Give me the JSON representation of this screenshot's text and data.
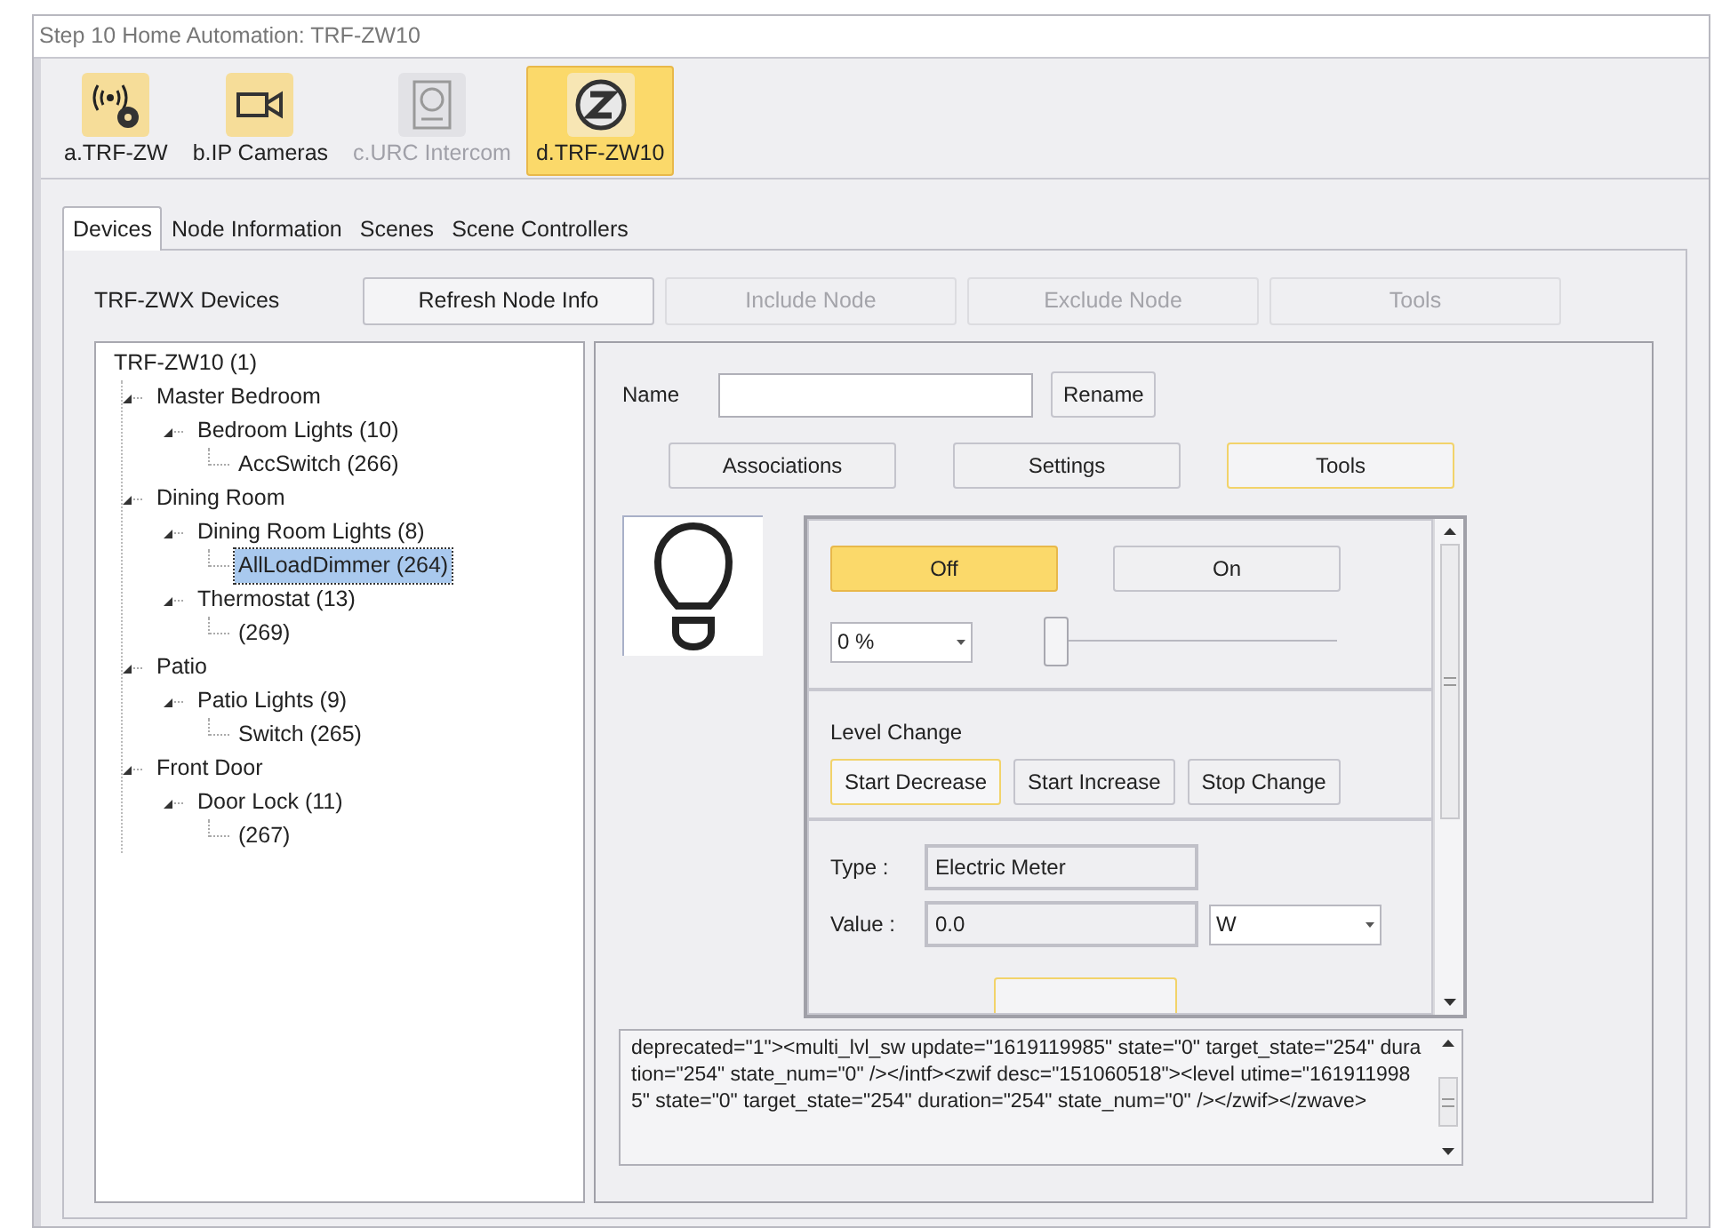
{
  "window": {
    "title": "Step 10 Home Automation: TRF-ZW10"
  },
  "modules": [
    {
      "label": "a.TRF-ZW",
      "kind": "signal",
      "selected": false,
      "disabled": false
    },
    {
      "label": "b.IP Cameras",
      "kind": "camera",
      "selected": false,
      "disabled": false
    },
    {
      "label": "c.URC Intercom",
      "kind": "intercom",
      "selected": false,
      "disabled": true
    },
    {
      "label": "d.TRF-ZW10",
      "kind": "zwave",
      "selected": true,
      "disabled": false
    }
  ],
  "tabs": [
    {
      "label": "Devices",
      "selected": true
    },
    {
      "label": "Node Information",
      "selected": false
    },
    {
      "label": "Scenes",
      "selected": false
    },
    {
      "label": "Scene Controllers",
      "selected": false
    }
  ],
  "devices_label": "TRF-ZWX Devices",
  "toolbar_buttons": [
    {
      "label": "Refresh Node Info",
      "disabled": false
    },
    {
      "label": "Include Node",
      "disabled": true
    },
    {
      "label": "Exclude Node",
      "disabled": true
    },
    {
      "label": "Tools",
      "disabled": true
    }
  ],
  "tree": {
    "label": "TRF-ZW10 (1)",
    "selected": false,
    "children": [
      {
        "label": "Master Bedroom",
        "selected": false,
        "expanded": true,
        "children": [
          {
            "label": "Bedroom Lights (10)",
            "selected": false,
            "expanded": true,
            "children": [
              {
                "label": "AccSwitch (266)",
                "selected": false
              }
            ]
          }
        ]
      },
      {
        "label": "Dining Room",
        "selected": false,
        "expanded": true,
        "children": [
          {
            "label": "Dining Room Lights (8)",
            "selected": false,
            "expanded": true,
            "children": [
              {
                "label": "AllLoadDimmer (264)",
                "selected": true
              }
            ]
          },
          {
            "label": "Thermostat (13)",
            "selected": false,
            "expanded": true,
            "children": [
              {
                "label": "(269)",
                "selected": false
              }
            ]
          }
        ]
      },
      {
        "label": "Patio",
        "selected": false,
        "expanded": true,
        "children": [
          {
            "label": "Patio Lights (9)",
            "selected": false,
            "expanded": true,
            "children": [
              {
                "label": "Switch (265)",
                "selected": false
              }
            ]
          }
        ]
      },
      {
        "label": "Front Door",
        "selected": false,
        "expanded": true,
        "children": [
          {
            "label": "Door Lock (11)",
            "selected": false,
            "expanded": true,
            "children": [
              {
                "label": "(267)",
                "selected": false
              }
            ]
          }
        ]
      }
    ]
  },
  "name_label": "Name",
  "rename_button": "Rename",
  "view_buttons": [
    {
      "label": "Associations",
      "selected": false
    },
    {
      "label": "Settings",
      "selected": false
    },
    {
      "label": "Tools",
      "selected": true
    }
  ],
  "switch_buttons": [
    {
      "label": "Off",
      "selected": true
    },
    {
      "label": "On",
      "selected": false
    }
  ],
  "level_select": {
    "value": "0 %"
  },
  "slider": {
    "level": 0
  },
  "level_change": {
    "title": "Level Change",
    "buttons": [
      {
        "label": "Start Decrease",
        "focused": true
      },
      {
        "label": "Start Increase",
        "focused": false
      },
      {
        "label": "Stop Change",
        "focused": false
      }
    ]
  },
  "meter": {
    "type_label": "Type :",
    "type_value": "Electric Meter",
    "value_label": "Value :",
    "value": "0.0",
    "unit": "W"
  },
  "log_text": "deprecated=\"1\"><multi_lvl_sw update=\"1619119985\" state=\"0\" target_state=\"254\" duration=\"254\" state_num=\"0\" /></intf><zwif desc=\"151060518\"><level utime=\"1619119985\" state=\"0\" target_state=\"254\" duration=\"254\" state_num=\"0\" /></zwif></zwave>"
}
